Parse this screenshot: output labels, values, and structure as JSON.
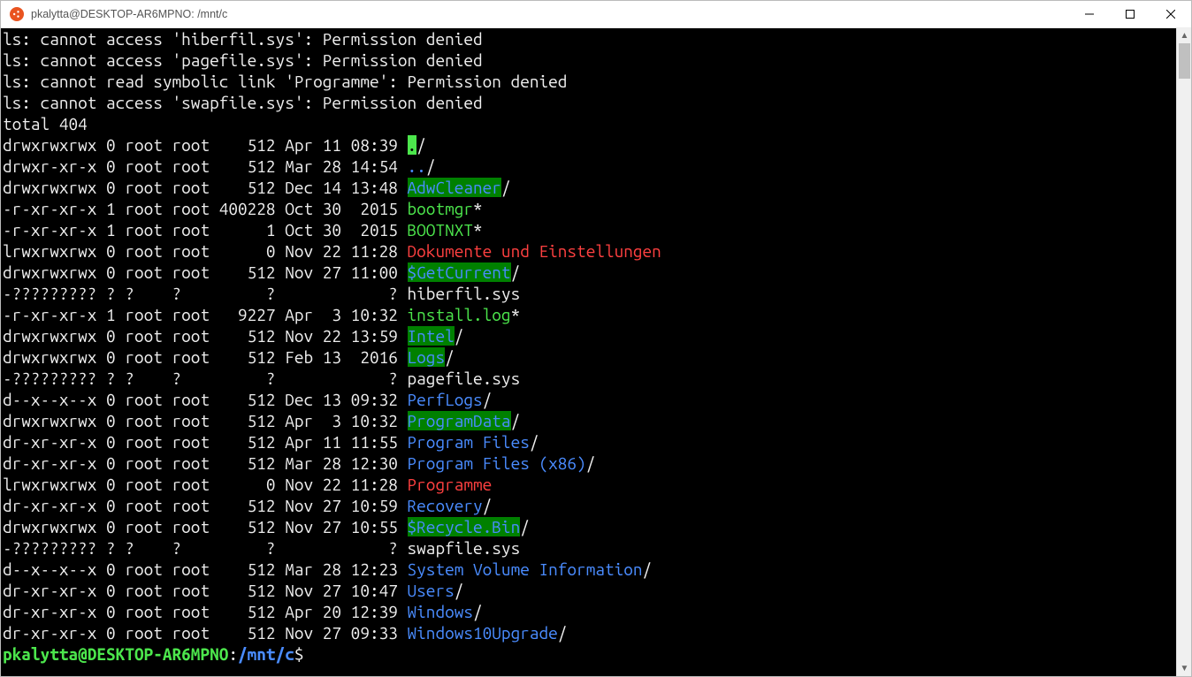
{
  "window": {
    "title": "pkalytta@DESKTOP-AR6MPNO: /mnt/c"
  },
  "errors": [
    "ls: cannot access 'hiberfil.sys': Permission denied",
    "ls: cannot access 'pagefile.sys': Permission denied",
    "ls: cannot read symbolic link 'Programme': Permission denied",
    "ls: cannot access 'swapfile.sys': Permission denied"
  ],
  "total_line": "total 404",
  "listing": [
    {
      "perm": "drwxrwxrwx",
      "n": "0",
      "u": "root",
      "g": "root",
      "size": "512",
      "date": "Apr 11 08:39",
      "name": ".",
      "suffix": "/",
      "cls": "inv-g"
    },
    {
      "perm": "drwxr-xr-x",
      "n": "0",
      "u": "root",
      "g": "root",
      "size": "512",
      "date": "Mar 28 14:54",
      "name": "..",
      "suffix": "/",
      "cls": "b"
    },
    {
      "perm": "drwxrwxrwx",
      "n": "0",
      "u": "root",
      "g": "root",
      "size": "512",
      "date": "Dec 14 13:48",
      "name": "AdwCleaner",
      "suffix": "/",
      "cls": "b bg-g"
    },
    {
      "perm": "-r-xr-xr-x",
      "n": "1",
      "u": "root",
      "g": "root",
      "size": "400228",
      "date": "Oct 30  2015",
      "name": "bootmgr",
      "suffix": "*",
      "cls": "g"
    },
    {
      "perm": "-r-xr-xr-x",
      "n": "1",
      "u": "root",
      "g": "root",
      "size": "1",
      "date": "Oct 30  2015",
      "name": "BOOTNXT",
      "suffix": "*",
      "cls": "g"
    },
    {
      "perm": "lrwxrwxrwx",
      "n": "0",
      "u": "root",
      "g": "root",
      "size": "0",
      "date": "Nov 22 11:28",
      "name": "Dokumente und Einstellungen",
      "suffix": "",
      "cls": "r"
    },
    {
      "perm": "drwxrwxrwx",
      "n": "0",
      "u": "root",
      "g": "root",
      "size": "512",
      "date": "Nov 27 11:00",
      "name": "$GetCurrent",
      "suffix": "/",
      "cls": "b bg-g"
    },
    {
      "perm": "-?????????",
      "n": "?",
      "u": "?",
      "g": "?",
      "size": "?",
      "date": "           ?",
      "name": "hiberfil.sys",
      "suffix": "",
      "cls": "w"
    },
    {
      "perm": "-r-xr-xr-x",
      "n": "1",
      "u": "root",
      "g": "root",
      "size": "9227",
      "date": "Apr  3 10:32",
      "name": "install.log",
      "suffix": "*",
      "cls": "g"
    },
    {
      "perm": "drwxrwxrwx",
      "n": "0",
      "u": "root",
      "g": "root",
      "size": "512",
      "date": "Nov 22 13:59",
      "name": "Intel",
      "suffix": "/",
      "cls": "b bg-g"
    },
    {
      "perm": "drwxrwxrwx",
      "n": "0",
      "u": "root",
      "g": "root",
      "size": "512",
      "date": "Feb 13  2016",
      "name": "Logs",
      "suffix": "/",
      "cls": "b bg-g"
    },
    {
      "perm": "-?????????",
      "n": "?",
      "u": "?",
      "g": "?",
      "size": "?",
      "date": "           ?",
      "name": "pagefile.sys",
      "suffix": "",
      "cls": "w"
    },
    {
      "perm": "d--x--x--x",
      "n": "0",
      "u": "root",
      "g": "root",
      "size": "512",
      "date": "Dec 13 09:32",
      "name": "PerfLogs",
      "suffix": "/",
      "cls": "b"
    },
    {
      "perm": "drwxrwxrwx",
      "n": "0",
      "u": "root",
      "g": "root",
      "size": "512",
      "date": "Apr  3 10:32",
      "name": "ProgramData",
      "suffix": "/",
      "cls": "b bg-g"
    },
    {
      "perm": "dr-xr-xr-x",
      "n": "0",
      "u": "root",
      "g": "root",
      "size": "512",
      "date": "Apr 11 11:55",
      "name": "Program Files",
      "suffix": "/",
      "cls": "b"
    },
    {
      "perm": "dr-xr-xr-x",
      "n": "0",
      "u": "root",
      "g": "root",
      "size": "512",
      "date": "Mar 28 12:30",
      "name": "Program Files (x86)",
      "suffix": "/",
      "cls": "b"
    },
    {
      "perm": "lrwxrwxrwx",
      "n": "0",
      "u": "root",
      "g": "root",
      "size": "0",
      "date": "Nov 22 11:28",
      "name": "Programme",
      "suffix": "",
      "cls": "r"
    },
    {
      "perm": "dr-xr-xr-x",
      "n": "0",
      "u": "root",
      "g": "root",
      "size": "512",
      "date": "Nov 27 10:59",
      "name": "Recovery",
      "suffix": "/",
      "cls": "b"
    },
    {
      "perm": "drwxrwxrwx",
      "n": "0",
      "u": "root",
      "g": "root",
      "size": "512",
      "date": "Nov 27 10:55",
      "name": "$Recycle.Bin",
      "suffix": "/",
      "cls": "b bg-g"
    },
    {
      "perm": "-?????????",
      "n": "?",
      "u": "?",
      "g": "?",
      "size": "?",
      "date": "           ?",
      "name": "swapfile.sys",
      "suffix": "",
      "cls": "w"
    },
    {
      "perm": "d--x--x--x",
      "n": "0",
      "u": "root",
      "g": "root",
      "size": "512",
      "date": "Mar 28 12:23",
      "name": "System Volume Information",
      "suffix": "/",
      "cls": "b"
    },
    {
      "perm": "dr-xr-xr-x",
      "n": "0",
      "u": "root",
      "g": "root",
      "size": "512",
      "date": "Nov 27 10:47",
      "name": "Users",
      "suffix": "/",
      "cls": "b"
    },
    {
      "perm": "dr-xr-xr-x",
      "n": "0",
      "u": "root",
      "g": "root",
      "size": "512",
      "date": "Apr 20 12:39",
      "name": "Windows",
      "suffix": "/",
      "cls": "b"
    },
    {
      "perm": "dr-xr-xr-x",
      "n": "0",
      "u": "root",
      "g": "root",
      "size": "512",
      "date": "Nov 27 09:33",
      "name": "Windows10Upgrade",
      "suffix": "/",
      "cls": "b"
    }
  ],
  "prompt": {
    "user_host": "pkalytta@DESKTOP-AR6MPNO",
    "sep": ":",
    "path": "/mnt/c",
    "symbol": "$"
  }
}
